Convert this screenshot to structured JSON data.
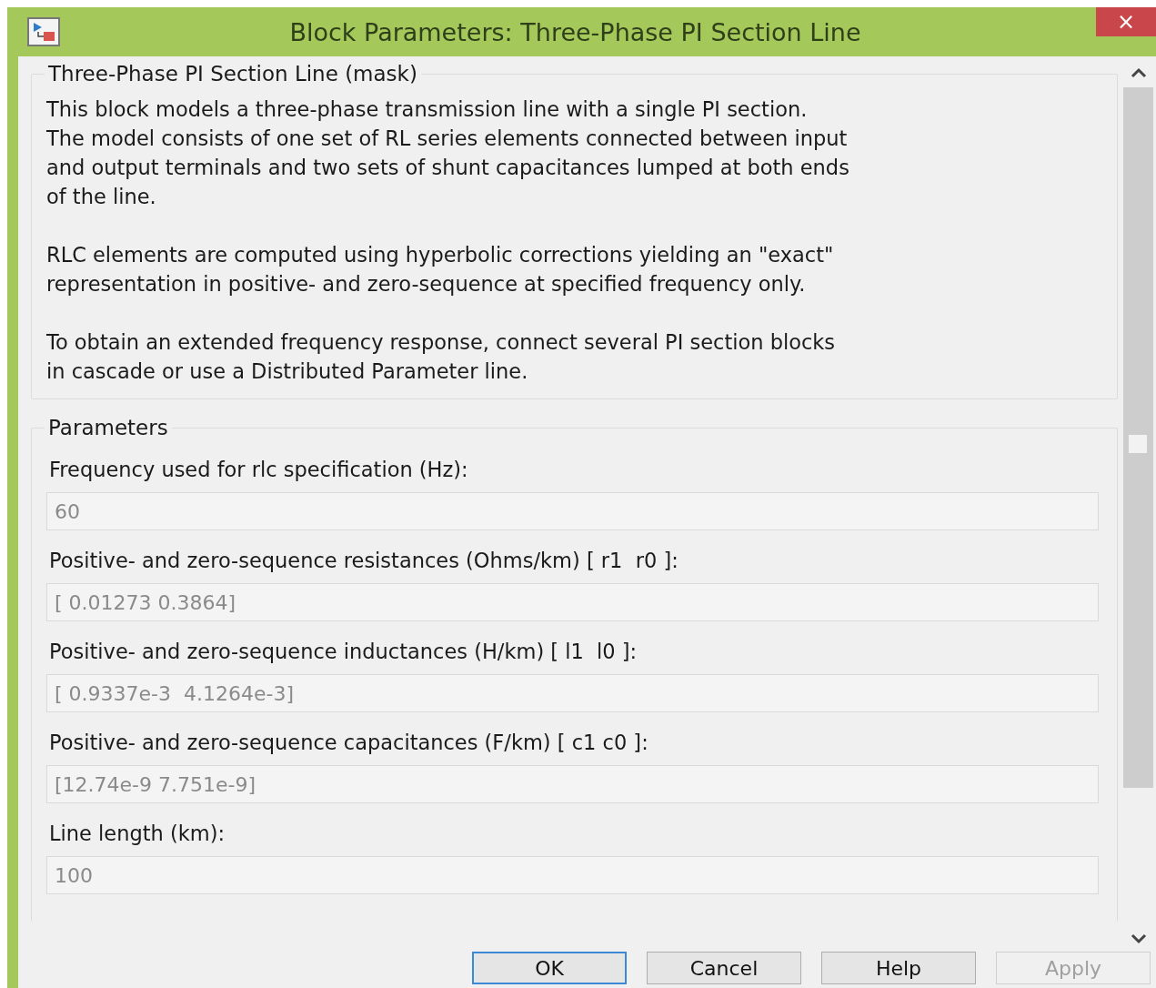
{
  "window": {
    "title": "Block Parameters: Three-Phase PI Section Line",
    "close": "×"
  },
  "mask": {
    "title": "Three-Phase PI Section Line (mask)",
    "paragraphs": [
      "This block models a three-phase transmission line with a single PI section.\nThe model consists of one set of RL series elements connected between input\nand output terminals and two sets of shunt capacitances lumped at both ends\nof the line.",
      "RLC elements are computed using hyperbolic corrections yielding an \"exact\"\nrepresentation in positive- and zero-sequence at specified frequency only.",
      "To obtain an extended frequency response, connect several PI section blocks\nin cascade or use a Distributed Parameter line."
    ]
  },
  "parameters": {
    "title": "Parameters",
    "items": [
      {
        "label": "Frequency used for rlc specification (Hz):",
        "value": "60",
        "disabled": true
      },
      {
        "label": "Positive- and zero-sequence resistances (Ohms/km) [ r1  r0 ]:",
        "value": "[ 0.01273 0.3864]",
        "disabled": true
      },
      {
        "label": "Positive- and zero-sequence inductances (H/km) [ l1  l0 ]:",
        "value": "[ 0.9337e-3  4.1264e-3]",
        "disabled": true
      },
      {
        "label": "Positive- and zero-sequence capacitances (F/km) [ c1 c0 ]:",
        "value": "[12.74e-9 7.751e-9]",
        "disabled": true
      },
      {
        "label": "Line length (km):",
        "value": "100",
        "disabled": true
      }
    ]
  },
  "buttons": [
    {
      "label": "OK",
      "disabled": false,
      "default": true
    },
    {
      "label": "Cancel",
      "disabled": false,
      "default": false
    },
    {
      "label": "Help",
      "disabled": false,
      "default": false
    },
    {
      "label": "Apply",
      "disabled": true,
      "default": false
    }
  ]
}
